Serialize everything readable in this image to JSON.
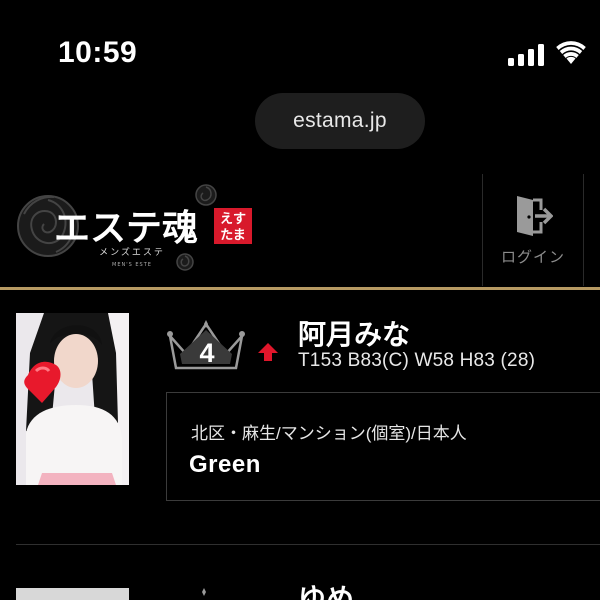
{
  "status_bar": {
    "time": "10:59",
    "signal_icon": "cellular-signal-icon",
    "wifi_icon": "wifi-icon"
  },
  "browser": {
    "url": "estama.jp"
  },
  "header": {
    "logo_text": "エステ魂",
    "logo_badge": "えすたま",
    "logo_sub": "メンズエステ",
    "logo_tiny": "MEN'S ESTE",
    "login_label": "ログイン",
    "login_icon": "login-door-icon"
  },
  "colors": {
    "background": "#000000",
    "accent_gold": "#b79a63",
    "rank_up_red": "#e0162b",
    "logo_badge_red": "#d8192b"
  },
  "ranking": [
    {
      "rank": "4",
      "trend": "up",
      "name": "阿月みな",
      "stats": "T153 B83(C) W58 H83 (28)",
      "area": "北区・麻生/マンション(個室)/日本人",
      "shop": "Green"
    },
    {
      "name": "ゆめ"
    }
  ]
}
